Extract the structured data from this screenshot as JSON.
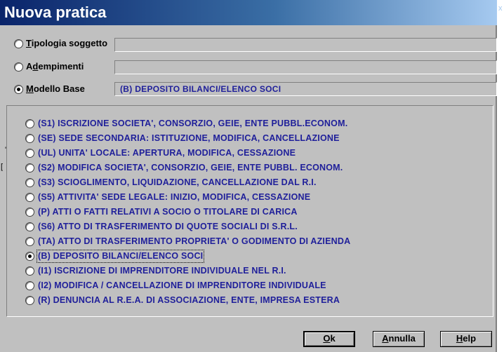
{
  "window": {
    "title": "Nuova pratica",
    "close_glyph": "x"
  },
  "top_options": [
    {
      "label": "Tipologia soggetto",
      "mnemonic": "T",
      "rest": "ipologia soggetto",
      "value": "",
      "checked": false
    },
    {
      "label": "Adempimenti",
      "mnemonic_pre": "A",
      "mnemonic": "d",
      "rest": "empimenti",
      "value": "",
      "checked": false
    },
    {
      "label": "Modello Base",
      "mnemonic": "M",
      "rest": "odello Base",
      "value": "(B)  DEPOSITO BILANCI/ELENCO SOCI",
      "checked": true
    }
  ],
  "models": [
    {
      "label": "(S1)  ISCRIZIONE SOCIETA', CONSORZIO, GEIE, ENTE PUBBL.ECONOM.",
      "checked": false
    },
    {
      "label": "(SE)  SEDE SECONDARIA: ISTITUZIONE, MODIFICA, CANCELLAZIONE",
      "checked": false
    },
    {
      "label": "(UL)  UNITA' LOCALE: APERTURA, MODIFICA, CESSAZIONE",
      "checked": false
    },
    {
      "label": "(S2)  MODIFICA  SOCIETA', CONSORZIO, GEIE, ENTE PUBBL. ECONOM.",
      "checked": false
    },
    {
      "label": "(S3)  SCIOGLIMENTO, LIQUIDAZIONE, CANCELLAZIONE DAL R.I.",
      "checked": false
    },
    {
      "label": "(S5)  ATTIVITA' SEDE LEGALE: INIZIO, MODIFICA, CESSAZIONE",
      "checked": false
    },
    {
      "label": "(P)  ATTI O FATTI RELATIVI A SOCIO O TITOLARE DI CARICA",
      "checked": false
    },
    {
      "label": "(S6)  ATTO DI TRASFERIMENTO DI QUOTE SOCIALI DI S.R.L.",
      "checked": false
    },
    {
      "label": "(TA)  ATTO DI TRASFERIMENTO PROPRIETA' O GODIMENTO DI AZIENDA",
      "checked": false
    },
    {
      "label": "(B)  DEPOSITO BILANCI/ELENCO SOCI",
      "checked": true
    },
    {
      "label": "(I1)  ISCRIZIONE DI IMPRENDITORE INDIVIDUALE NEL R.I.",
      "checked": false
    },
    {
      "label": "(I2)  MODIFICA / CANCELLAZIONE DI IMPRENDITORE INDIVIDUALE",
      "checked": false
    },
    {
      "label": "(R)  DENUNCIA AL R.E.A. DI ASSOCIAZIONE, ENTE, IMPRESA ESTERA",
      "checked": false
    }
  ],
  "buttons": {
    "ok": {
      "mnemonic": "O",
      "rest": "k"
    },
    "annulla": {
      "mnemonic": "A",
      "rest": "nnulla"
    },
    "help": {
      "mnemonic": "H",
      "rest": "elp"
    }
  },
  "edge_marks": [
    "'",
    "["
  ],
  "colors": {
    "title_start": "#0a246a",
    "title_end": "#a6caf0",
    "face": "#c0c0c0",
    "option_text": "#1f1f9a"
  }
}
